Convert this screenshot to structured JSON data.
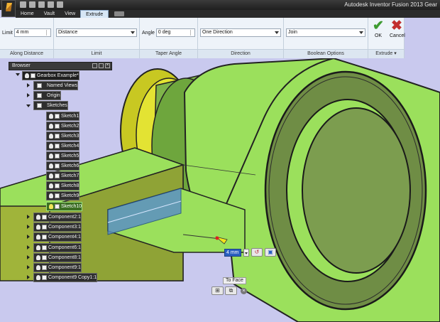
{
  "window": {
    "title": "Autodesk Inventor Fusion 2013   Gear"
  },
  "tabs": [
    {
      "label": "Home"
    },
    {
      "label": "Vault"
    },
    {
      "label": "View"
    },
    {
      "label": "Extrude"
    }
  ],
  "ribbon": {
    "limit_label": "Limit",
    "limit_value": "4 mm",
    "distance_value": "Distance",
    "angle_label": "Angle",
    "angle_value": "0 deg",
    "direction_value": "One Direction",
    "boolean_value": "Join",
    "ok_label": "OK",
    "cancel_label": "Cancel",
    "panel_labels": [
      "Along Distance",
      "Limit",
      "Taper Angle",
      "Direction",
      "Boolean Options",
      "Extrude"
    ]
  },
  "browser": {
    "title": "Browser",
    "root": "Gearbox Example*",
    "folders": [
      "Named Views",
      "Origin",
      "Sketches"
    ],
    "sketches": [
      "Sketch1",
      "Sketch2",
      "Sketch3",
      "Sketch4",
      "Sketch5",
      "Sketch6",
      "Sketch7",
      "Sketch8",
      "Sketch9",
      "Sketch10"
    ],
    "components": [
      "Component2:1",
      "Component3:1",
      "Component4:1",
      "Component6:1",
      "Component8:1",
      "Component9:1",
      "Component9 Copy1:1"
    ]
  },
  "minitoolbar": {
    "value": "4 mm"
  },
  "to_face": {
    "label": "To Face"
  },
  "colors": {
    "part_green": "#9be05c",
    "part_yellow": "#d6d62a",
    "background": "#c9c9ee",
    "preview_blue": "#5b8fc4"
  }
}
